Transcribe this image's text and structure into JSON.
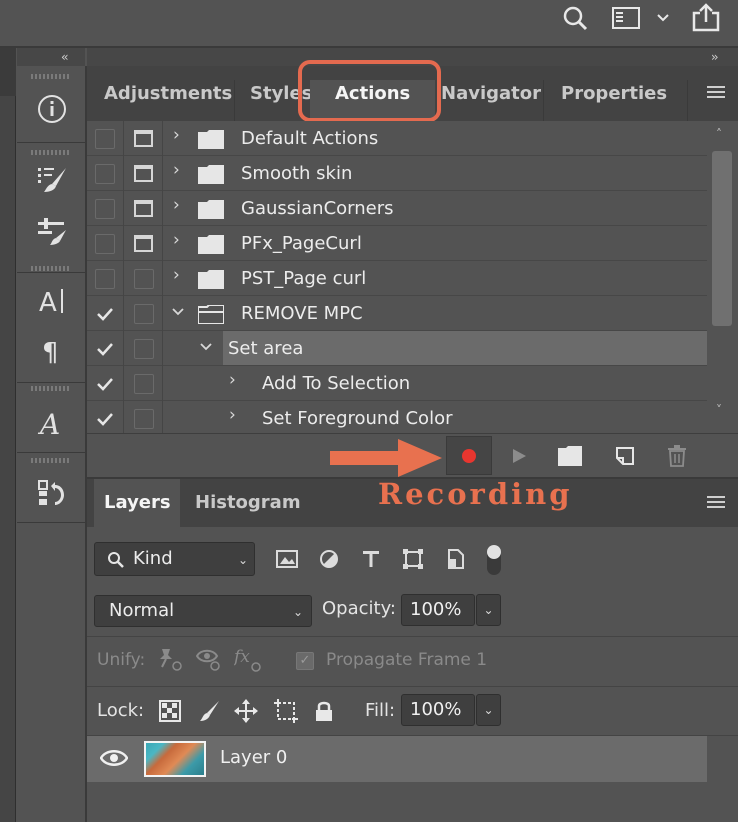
{
  "panels": {
    "actions_tabs": [
      "Adjustments",
      "Styles",
      "Actions",
      "Navigator",
      "Properties"
    ],
    "active_actions_tab": "Actions",
    "layers_tabs": [
      "Layers",
      "Histogram"
    ],
    "active_layers_tab": "Layers"
  },
  "actions": {
    "rows": [
      {
        "label": "Default Actions",
        "checked": false,
        "dialog": true,
        "expanded": false
      },
      {
        "label": "Smooth skin",
        "checked": false,
        "dialog": true,
        "expanded": false
      },
      {
        "label": "GaussianCorners",
        "checked": false,
        "dialog": true,
        "expanded": false
      },
      {
        "label": "PFx_PageCurl",
        "checked": false,
        "dialog": true,
        "expanded": false
      },
      {
        "label": "PST_Page curl",
        "checked": false,
        "dialog": false,
        "expanded": false
      },
      {
        "label": "REMOVE MPC",
        "checked": true,
        "dialog": false,
        "expanded": true
      },
      {
        "label": "Set area",
        "checked": true,
        "dialog": false,
        "expanded": true
      },
      {
        "label": "Add To Selection",
        "checked": true,
        "dialog": false,
        "expanded": false
      },
      {
        "label": "Set Foreground Color",
        "checked": true,
        "dialog": false,
        "expanded": false
      }
    ],
    "annotation": "Recording",
    "recording": true
  },
  "layers": {
    "filter": {
      "kind": "Kind"
    },
    "blend_mode": "Normal",
    "opacity_label": "Opacity:",
    "opacity_value": "100%",
    "unify_label": "Unify:",
    "propagate_label": "Propagate Frame 1",
    "lock_label": "Lock:",
    "fill_label": "Fill:",
    "fill_value": "100%",
    "layer_name": "Layer 0"
  },
  "colors": {
    "annotation": "#e8714f",
    "record_dot": "#e8362f"
  }
}
